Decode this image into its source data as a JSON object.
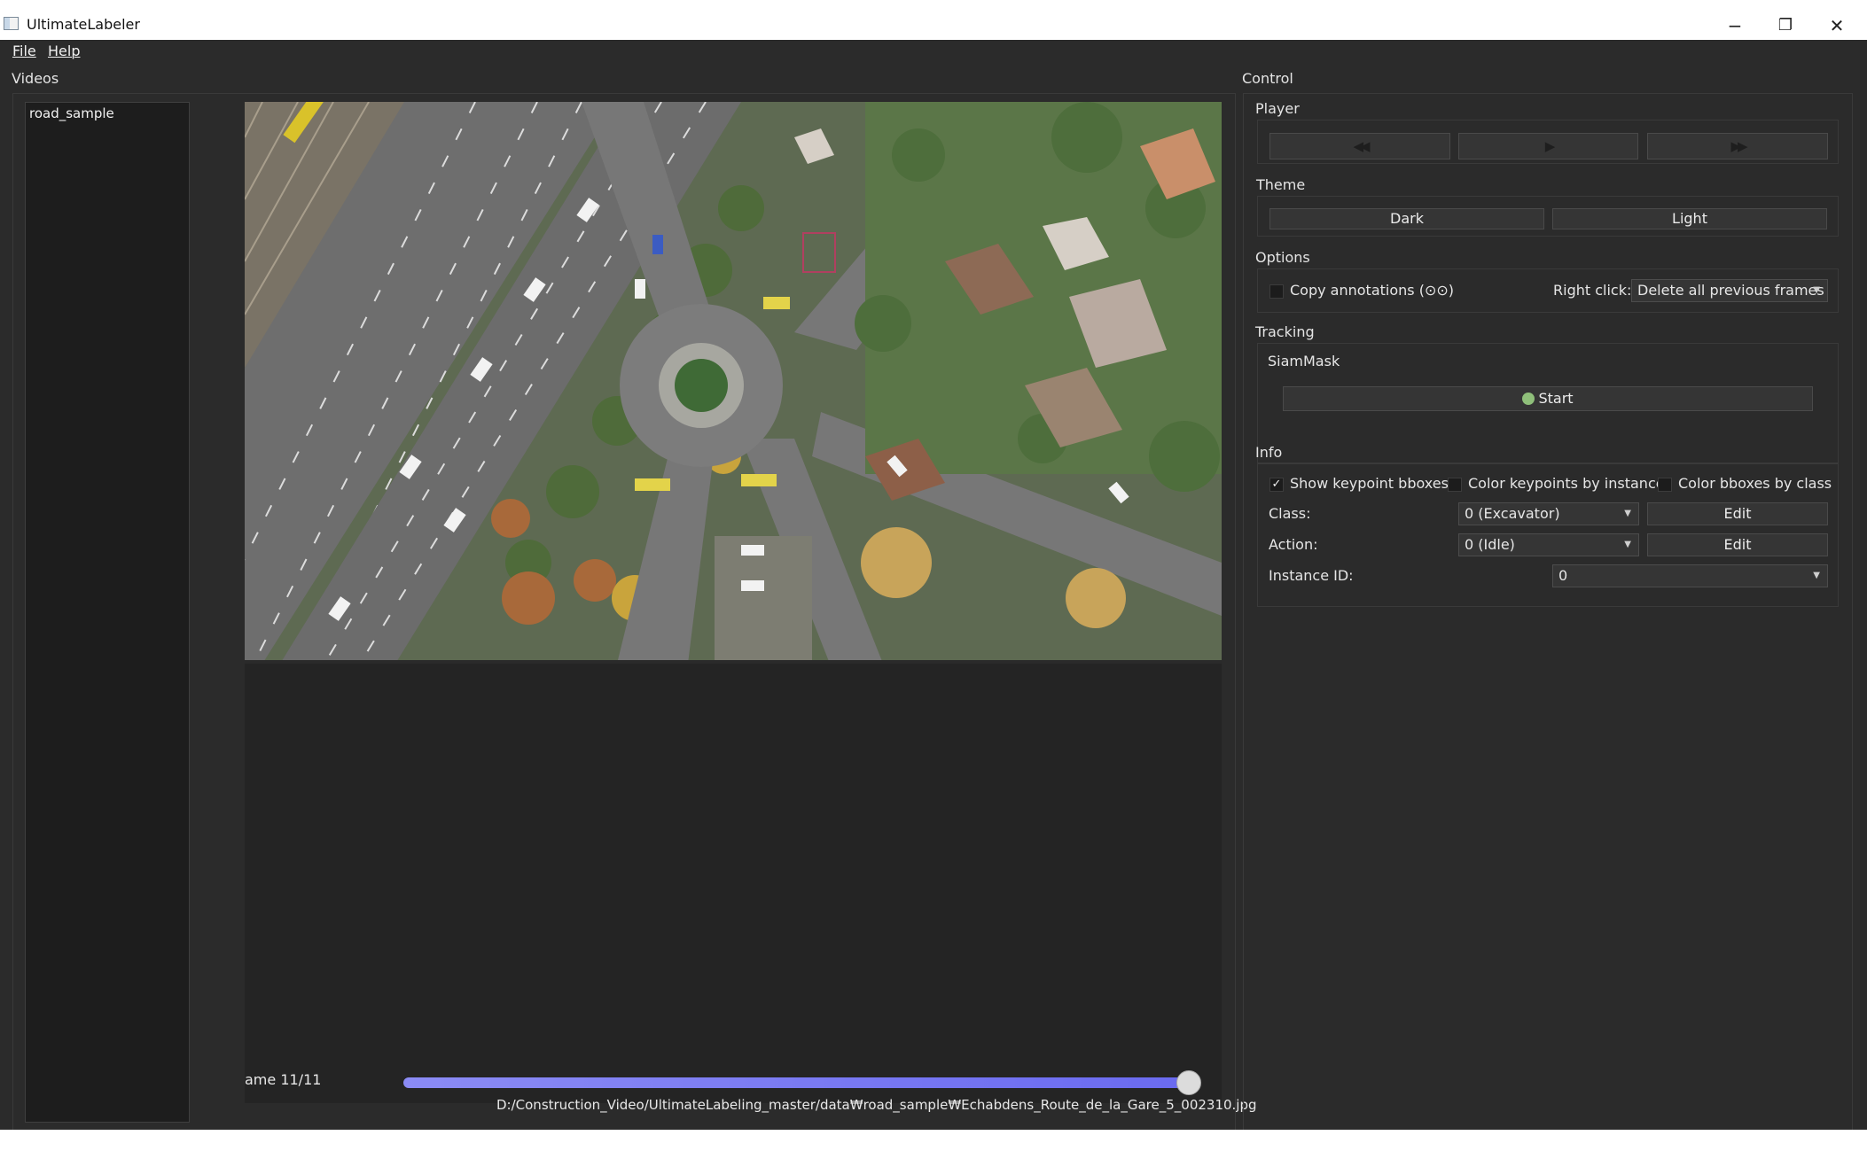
{
  "window": {
    "title": "UltimateLabeler",
    "minimize": "−",
    "maximize": "❐",
    "close": "✕"
  },
  "menu": {
    "file": "File",
    "help": "Help"
  },
  "videos": {
    "title": "Videos",
    "items": [
      "road_sample"
    ]
  },
  "viewer": {
    "frame_label": "ame 11/11",
    "frame_progress": 1.0,
    "file_path": "D:/Construction_Video/UltimateLabeling_master/data₩road_sample₩Echabdens_Route_de_la_Gare_5_002310.jpg"
  },
  "control": {
    "title": "Control",
    "player": {
      "title": "Player",
      "prev_icon": "rewind-icon",
      "play_icon": "play-icon",
      "next_icon": "fast-forward-icon"
    },
    "theme": {
      "title": "Theme",
      "dark": "Dark",
      "light": "Light"
    },
    "options": {
      "title": "Options",
      "copy_annotations": "Copy annotations (⊙⊙)",
      "copy_checked": false,
      "right_click_label": "Right click:",
      "right_click_value": "Delete all previous frames"
    },
    "tracking": {
      "title": "Tracking",
      "tracker": "SiamMask",
      "start": "Start"
    },
    "info": {
      "title": "Info",
      "show_keypoint_bboxes": "Show keypoint bboxes",
      "show_keypoint_checked": true,
      "color_keypoints": "Color keypoints by instance",
      "color_bboxes": "Color bboxes by class",
      "class_label": "Class:",
      "class_value": "0 (Excavator)",
      "action_label": "Action:",
      "action_value": "0 (Idle)",
      "instance_label": "Instance ID:",
      "instance_value": "0",
      "edit": "Edit"
    }
  }
}
